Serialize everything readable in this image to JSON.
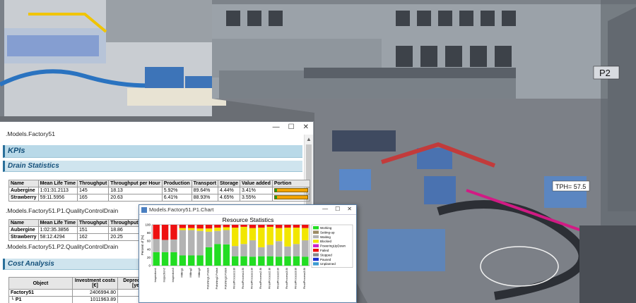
{
  "report": {
    "path_top": ".Models.Factory51",
    "kpis_title": "KPIs",
    "drain_title": "Drain Statistics",
    "drain_columns": [
      "Name",
      "Mean Life Time",
      "Throughput",
      "Throughput per Hour",
      "Production",
      "Transport",
      "Storage",
      "Value added",
      "Portion"
    ],
    "drain_rows": [
      {
        "name": "Aubergine",
        "life": "1:01:31.2113",
        "tp": "145",
        "tph": "18.13",
        "prod": "5.92%",
        "trans": "89.64%",
        "stor": "4.44%",
        "va": "3.41%",
        "portion": 0.06
      },
      {
        "name": "Strawberry",
        "life": "59:11.5956",
        "tp": "165",
        "tph": "20.63",
        "prod": "6.41%",
        "trans": "88.93%",
        "stor": "4.65%",
        "va": "3.55%",
        "portion": 0.06
      }
    ],
    "path_p1": ".Models.Factory51.P1.QualityControlDrain",
    "drain2_columns": [
      "Name",
      "Mean Life Time",
      "Throughput",
      "Throughput per Ho"
    ],
    "drain2_rows": [
      {
        "name": "Aubergine",
        "life": "1:02:35.3856",
        "tp": "151",
        "tph": "18.86"
      },
      {
        "name": "Strawberry",
        "life": "58:12.4294",
        "tp": "162",
        "tph": "20.25"
      }
    ],
    "path_p2": ".Models.Factory51.P2.QualityControlDrain",
    "cost_title": "Cost Analysis",
    "cost_columns": [
      "Object",
      "Investment costs [€]",
      "Depreciation p [years]"
    ],
    "cost_rows": [
      {
        "obj": "Factory51",
        "inv": "2406994.80"
      },
      {
        "obj": "└ P1",
        "inv": "1011963.89"
      }
    ]
  },
  "chart_window": {
    "title": "Models.Factory51.P1.Chart"
  },
  "chart_data": {
    "type": "bar",
    "stacked": true,
    "title": "Resource Statistics",
    "ylabel": "Percent of [%]",
    "ylim": [
      0,
      100
    ],
    "yticks": [
      0,
      20,
      40,
      60,
      80,
      100
    ],
    "categories": [
      "Inspection1",
      "Inspection2",
      "Inspection3",
      "Milling1",
      "Milling2",
      "Milling3",
      "Polishing1.Polish",
      "Polishing2.Polish",
      "Polishing3.Polish",
      "FinalProcess1.Bl",
      "FinalProcess1.Bl",
      "FinalProcess1.Bl",
      "FinalProcess2.Bl",
      "FinalProcess2.Bl",
      "FinalProcess2.Bl",
      "FinalProcess3.Bl",
      "FinalProcess3.Bl",
      "FinalProcess3.Bl"
    ],
    "series": [
      {
        "name": "Working",
        "color": "#22dd22",
        "values": [
          33,
          33,
          33,
          25,
          25,
          25,
          45,
          53,
          52,
          23,
          23,
          22,
          23,
          23,
          22,
          23,
          23,
          22
        ]
      },
      {
        "name": "Setting-up",
        "color": "#9b8a63",
        "values": [
          0,
          0,
          0,
          0,
          0,
          0,
          0,
          0,
          0,
          0,
          0,
          0,
          0,
          0,
          0,
          0,
          0,
          0
        ]
      },
      {
        "name": "Waiting",
        "color": "#b3b3b3",
        "values": [
          32,
          30,
          31,
          62,
          62,
          60,
          38,
          32,
          35,
          25,
          30,
          40,
          22,
          28,
          38,
          24,
          30,
          40
        ]
      },
      {
        "name": "Blocked",
        "color": "#f2e600",
        "values": [
          0,
          0,
          0,
          5,
          5,
          6,
          8,
          8,
          7,
          45,
          42,
          30,
          48,
          44,
          32,
          46,
          40,
          30
        ]
      },
      {
        "name": "PoweringUpDown",
        "color": "#cc22cc",
        "values": [
          0,
          0,
          0,
          0,
          0,
          0,
          0,
          0,
          0,
          0,
          0,
          0,
          0,
          0,
          0,
          0,
          0,
          0
        ]
      },
      {
        "name": "Failed",
        "color": "#ee1111",
        "values": [
          35,
          37,
          36,
          8,
          8,
          9,
          9,
          7,
          6,
          7,
          5,
          8,
          7,
          5,
          8,
          7,
          7,
          8
        ]
      },
      {
        "name": "Stopped",
        "color": "#888888",
        "values": [
          0,
          0,
          0,
          0,
          0,
          0,
          0,
          0,
          0,
          0,
          0,
          0,
          0,
          0,
          0,
          0,
          0,
          0
        ]
      },
      {
        "name": "Paused",
        "color": "#1a2fd0",
        "values": [
          0,
          0,
          0,
          0,
          0,
          0,
          0,
          0,
          0,
          0,
          0,
          0,
          0,
          0,
          0,
          0,
          0,
          0
        ]
      },
      {
        "name": "Unplanned",
        "color": "#3a9ad0",
        "values": [
          0,
          0,
          0,
          0,
          0,
          0,
          0,
          0,
          0,
          0,
          0,
          0,
          0,
          0,
          0,
          0,
          0,
          0
        ]
      }
    ]
  },
  "factory_labels": {
    "p2": "P2",
    "tph": "TPH= 57.5"
  }
}
